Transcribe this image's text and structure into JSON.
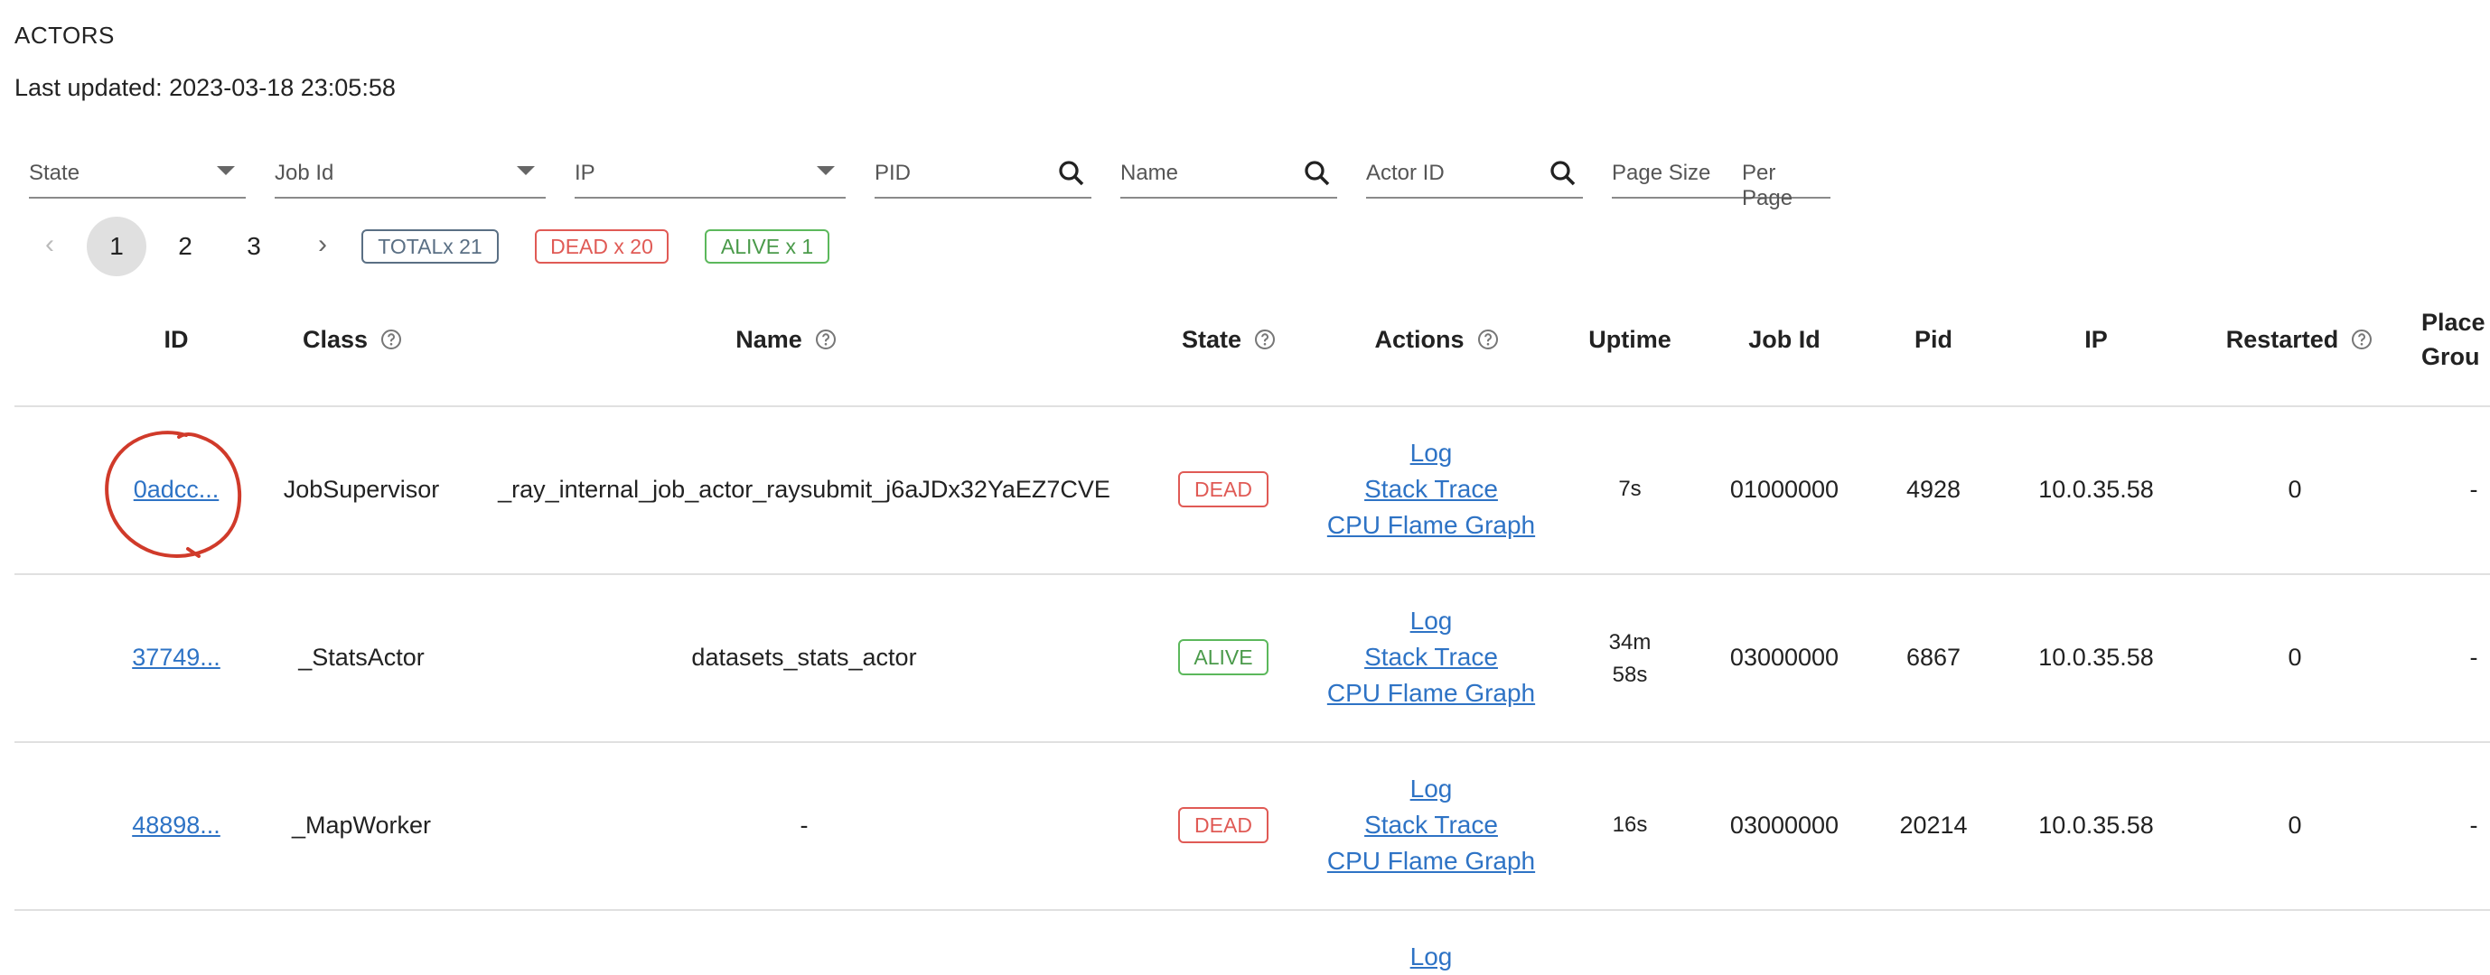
{
  "header": {
    "title": "ACTORS",
    "last_updated": "Last updated: 2023-03-18 23:05:58"
  },
  "filters": {
    "state": "State",
    "job_id": "Job Id",
    "ip": "IP",
    "pid": "PID",
    "name": "Name",
    "actor_id": "Actor ID",
    "page_size": "Page Size",
    "per_page": "Per Page"
  },
  "pagination": {
    "prev": "‹",
    "next": "›",
    "pages": [
      "1",
      "2",
      "3"
    ],
    "current": "1",
    "chips": {
      "total": "TOTALx 21",
      "dead": "DEAD x 20",
      "alive": "ALIVE x 1"
    }
  },
  "columns": {
    "id": "ID",
    "class": "Class",
    "name": "Name",
    "state": "State",
    "actions": "Actions",
    "uptime": "Uptime",
    "job_id": "Job Id",
    "pid": "Pid",
    "ip": "IP",
    "restarted": "Restarted",
    "placement_line1": "Place",
    "placement_line2": "Grou"
  },
  "rows": [
    {
      "id": "0adcc...",
      "class": "JobSupervisor",
      "name": "_ray_internal_job_actor_raysubmit_j6aJDx32YaEZ7CVE",
      "state": "DEAD",
      "actions": {
        "log": "Log",
        "stack": "Stack Trace",
        "flame": "CPU Flame Graph"
      },
      "uptime_line1": "7s",
      "uptime_line2": "",
      "job_id": "01000000",
      "pid": "4928",
      "ip": "10.0.35.58",
      "restarted": "0",
      "placement": "-"
    },
    {
      "id": "37749...",
      "class": "_StatsActor",
      "name": "datasets_stats_actor",
      "state": "ALIVE",
      "actions": {
        "log": "Log",
        "stack": "Stack Trace",
        "flame": "CPU Flame Graph"
      },
      "uptime_line1": "34m",
      "uptime_line2": "58s",
      "job_id": "03000000",
      "pid": "6867",
      "ip": "10.0.35.58",
      "restarted": "0",
      "placement": "-"
    },
    {
      "id": "48898...",
      "class": "_MapWorker",
      "name": "-",
      "state": "DEAD",
      "actions": {
        "log": "Log",
        "stack": "Stack Trace",
        "flame": "CPU Flame Graph"
      },
      "uptime_line1": "16s",
      "uptime_line2": "",
      "job_id": "03000000",
      "pid": "20214",
      "ip": "10.0.35.58",
      "restarted": "0",
      "placement": "-"
    }
  ],
  "partial_row": {
    "log": "Log"
  },
  "colors": {
    "link": "#2e73c5",
    "dead": "#e05a55",
    "alive": "#5cb85c",
    "annotation": "#d03a2a"
  }
}
